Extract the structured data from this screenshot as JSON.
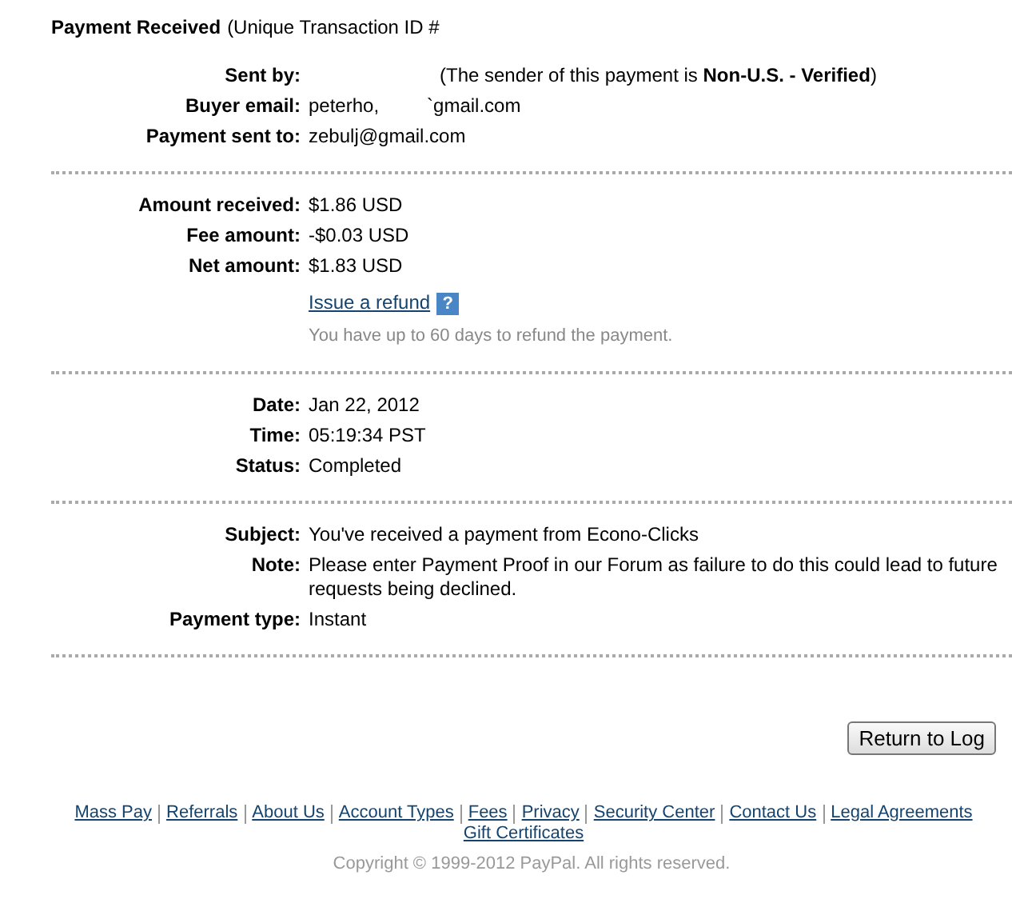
{
  "header": {
    "title": "Payment Received",
    "subtitle": "(Unique Transaction ID #"
  },
  "sections": [
    {
      "rows": [
        {
          "kind": "sender",
          "label": "Sent by:",
          "value": "(The sender of this payment is **Non-U.S. - Verified**)"
        },
        {
          "kind": "text",
          "label": "Buyer email:",
          "value": "peterho,         `gmail.com"
        },
        {
          "kind": "text",
          "label": "Payment sent to:",
          "value": "zebulj@gmail.com"
        }
      ]
    },
    {
      "rows": [
        {
          "kind": "text",
          "label": "Amount received:",
          "value": "$1.86 USD"
        },
        {
          "kind": "text",
          "label": "Fee amount:",
          "value": "-$0.03 USD"
        },
        {
          "kind": "text",
          "label": "Net amount:",
          "value": "$1.83 USD"
        },
        {
          "kind": "link",
          "value": "Issue a refund",
          "help": "?"
        },
        {
          "kind": "hint",
          "value": "You have up to 60 days to refund the payment."
        }
      ]
    },
    {
      "rows": [
        {
          "kind": "text",
          "label": "Date:",
          "value": "Jan 22, 2012"
        },
        {
          "kind": "text",
          "label": "Time:",
          "value": "05:19:34 PST"
        },
        {
          "kind": "text",
          "label": "Status:",
          "value": "Completed"
        }
      ]
    },
    {
      "rows": [
        {
          "kind": "text",
          "label": "Subject:",
          "value": "You've received a payment from Econo-Clicks"
        },
        {
          "kind": "text",
          "label": "Note:",
          "value": "Please enter Payment Proof in our Forum as failure to do this could lead to future requests being declined."
        },
        {
          "kind": "text",
          "label": "Payment type:",
          "value": "Instant"
        }
      ]
    }
  ],
  "return_button": "Return to Log",
  "footer_links": [
    "Mass Pay",
    "Referrals",
    "About Us",
    "Account Types",
    "Fees",
    "Privacy",
    "Security Center",
    "Contact Us",
    "Legal Agreements",
    "Gift Certificates"
  ],
  "copyright": "Copyright © 1999-2012 PayPal. All rights reserved."
}
